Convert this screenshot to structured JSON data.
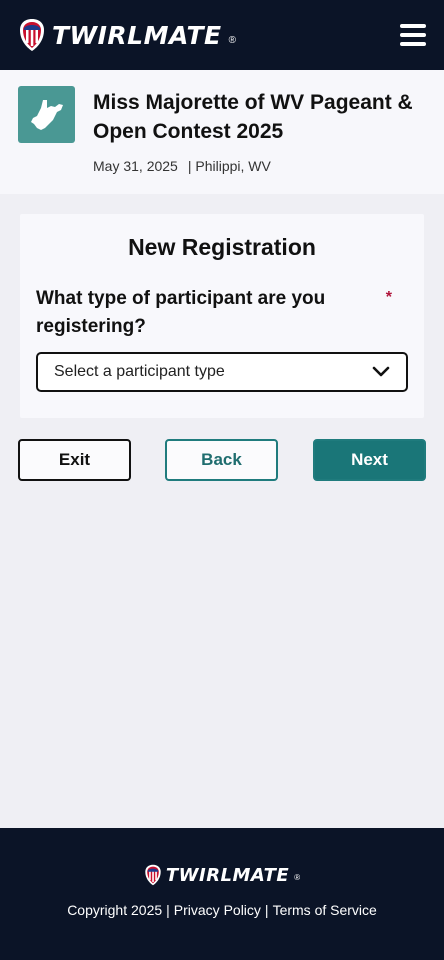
{
  "brand": {
    "name": "TWIRLMATE",
    "reg_mark": "®"
  },
  "header": {
    "menu_icon": "hamburger-menu-icon"
  },
  "event": {
    "thumb_icon": "west-virginia-state-icon",
    "title": "Miss Majorette of WV Pageant & Open Contest 2025",
    "date": "May 31, 2025",
    "location": "| Philippi, WV"
  },
  "form": {
    "title": "New Registration",
    "question": "What type of participant are you registering?",
    "required_mark": "*",
    "select_placeholder": "Select a participant type",
    "select_icon": "chevron-down-icon"
  },
  "actions": {
    "exit": "Exit",
    "back": "Back",
    "next": "Next"
  },
  "footer": {
    "copyright": "Copyright 2025",
    "sep1": "|",
    "privacy": "Privacy Policy",
    "sep2": "|",
    "terms": "Terms of Service"
  },
  "colors": {
    "navy": "#0b1427",
    "teal": "#1a7678",
    "thumb_teal": "#4a9894",
    "required_red": "#b0153b"
  }
}
